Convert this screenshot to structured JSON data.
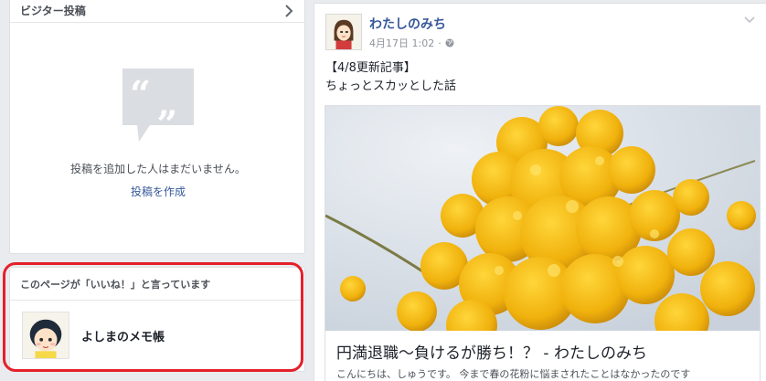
{
  "left": {
    "visitor_posts": {
      "title": "ビジター投稿",
      "empty_text": "投稿を追加した人はまだいません。",
      "create_link": "投稿を作成"
    },
    "likes": {
      "title": "このページが「いいね！」と言っています",
      "page_name": "よしまのメモ帳"
    }
  },
  "post": {
    "author": "わたしのみち",
    "time": "4月17日 1:02",
    "dot": "·",
    "text_line1": "【4/8更新記事】",
    "text_line2": "ちょっとスカッとした話",
    "preview_title": "円満退職〜負けるが勝ち！？ - わたしのみち",
    "preview_desc": "こんにちは、しゅうです。 今まで春の花粉に悩まされたことはなかったのです"
  },
  "colors": {
    "link": "#365899",
    "highlight_outline": "#e5202a",
    "mimosa_yellow": "#f2b90f"
  }
}
